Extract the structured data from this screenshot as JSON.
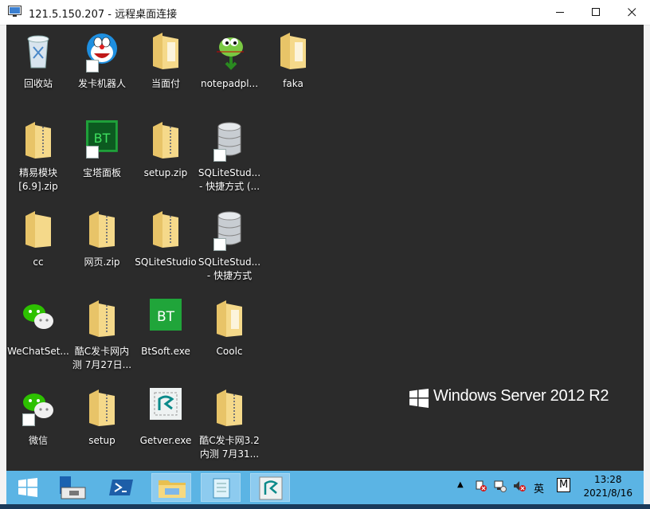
{
  "window": {
    "title": "121.5.150.207 - 远程桌面连接",
    "controls": {
      "minimize": "minimize-icon",
      "maximize": "maximize-icon",
      "close": "close-icon"
    }
  },
  "desktop": {
    "icons": [
      {
        "label": "回收站",
        "icon": "recycle-bin-icon"
      },
      {
        "label": "发卡机器人",
        "icon": "doraemon-icon"
      },
      {
        "label": "当面付",
        "icon": "folder-icon"
      },
      {
        "label": "notepadpl...",
        "icon": "notepadpp-icon"
      },
      {
        "label": "faka",
        "icon": "folder-icon"
      },
      {
        "label": "精易模块\n[6.9].zip",
        "icon": "zip-folder-icon"
      },
      {
        "label": "宝塔面板",
        "icon": "bt-panel-icon"
      },
      {
        "label": "setup.zip",
        "icon": "zip-folder-icon"
      },
      {
        "label": "SQLiteStud...\n- 快捷方式 (...",
        "icon": "database-icon"
      },
      {
        "label": "cc",
        "icon": "folder-icon"
      },
      {
        "label": "网页.zip",
        "icon": "zip-folder-icon"
      },
      {
        "label": "SQLiteStudio",
        "icon": "zip-folder-icon"
      },
      {
        "label": "SQLiteStud...\n- 快捷方式",
        "icon": "database-icon"
      },
      {
        "label": "WeChatSet...",
        "icon": "wechat-icon"
      },
      {
        "label": "酷C发卡网内\n测 7月27日...",
        "icon": "zip-folder-icon"
      },
      {
        "label": "BtSoft.exe",
        "icon": "bt-soft-icon"
      },
      {
        "label": "Coolc",
        "icon": "folder-icon"
      },
      {
        "label": "微信",
        "icon": "wechat-icon"
      },
      {
        "label": "setup",
        "icon": "zip-folder-icon"
      },
      {
        "label": "Getver.exe",
        "icon": "getver-icon"
      },
      {
        "label": "酷C发卡网3.2\n内测 7月31...",
        "icon": "zip-folder-icon"
      }
    ],
    "watermark": "Windows Server 2012 R2"
  },
  "taskbar": {
    "buttons": [
      "start-icon",
      "server-manager-icon",
      "powershell-icon",
      "file-explorer-icon",
      "notepad-icon",
      "getver-icon"
    ],
    "tray": {
      "ime_lang": "英",
      "ime_mode": "M"
    },
    "clock": {
      "time": "13:28",
      "date": "2021/8/16"
    }
  },
  "colors": {
    "desktop_bg": "#2b2b2b",
    "taskbar_bg": "#5bb4e4",
    "titlebar_bg": "#ffffff"
  }
}
